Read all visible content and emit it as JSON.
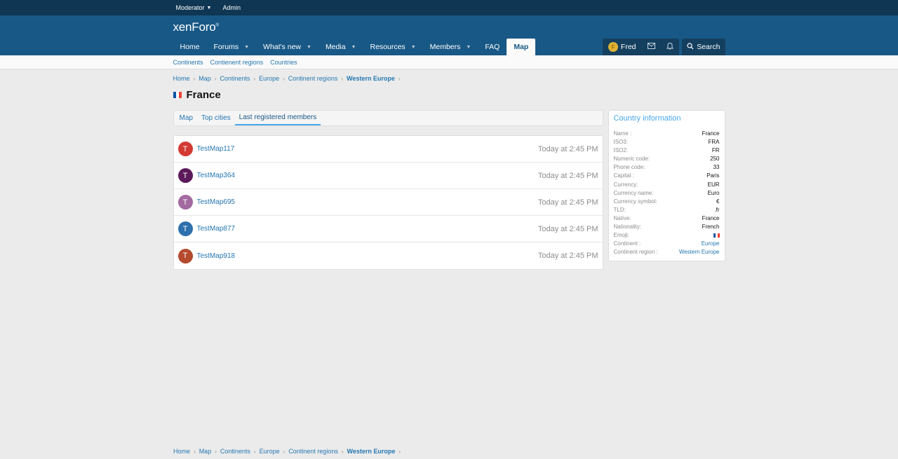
{
  "staffbar": {
    "moderator": "Moderator",
    "admin": "Admin"
  },
  "header": {
    "logo": "xenForo",
    "nav": [
      {
        "label": "Home",
        "dropdown": false
      },
      {
        "label": "Forums",
        "dropdown": true
      },
      {
        "label": "What's new",
        "dropdown": true
      },
      {
        "label": "Media",
        "dropdown": true
      },
      {
        "label": "Resources",
        "dropdown": true
      },
      {
        "label": "Members",
        "dropdown": true
      },
      {
        "label": "FAQ",
        "dropdown": false
      },
      {
        "label": "Map",
        "dropdown": false
      }
    ],
    "user": "Fred",
    "user_initial": "F",
    "search": "Search"
  },
  "subnav": [
    "Continents",
    "Contienent regions",
    "Countries"
  ],
  "breadcrumb": [
    "Home",
    "Map",
    "Continents",
    "Europe",
    "Continent regions",
    "Western Europe"
  ],
  "page": {
    "title": "France",
    "flag_colors": [
      "#0055a4",
      "#ffffff",
      "#ef4135"
    ]
  },
  "tabs": [
    "Map",
    "Top cities",
    "Last registered members"
  ],
  "members": [
    {
      "initial": "T",
      "name": "TestMap117",
      "time": "Today at 2:45 PM",
      "color": "#d33a34"
    },
    {
      "initial": "T",
      "name": "TestMap364",
      "time": "Today at 2:45 PM",
      "color": "#5c1a5b"
    },
    {
      "initial": "T",
      "name": "TestMap695",
      "time": "Today at 2:45 PM",
      "color": "#a26aa0"
    },
    {
      "initial": "T",
      "name": "TestMap877",
      "time": "Today at 2:45 PM",
      "color": "#2e6fad"
    },
    {
      "initial": "T",
      "name": "TestMap918",
      "time": "Today at 2:45 PM",
      "color": "#b54a2e"
    }
  ],
  "country_info": {
    "title": "Country information",
    "rows": [
      {
        "k": "Name :",
        "v": "France"
      },
      {
        "k": "ISO3:",
        "v": "FRA"
      },
      {
        "k": "ISO2:",
        "v": "FR"
      },
      {
        "k": "Numeric code:",
        "v": "250"
      },
      {
        "k": "Phone code:",
        "v": "33"
      },
      {
        "k": "Capital :",
        "v": "Paris"
      },
      {
        "k": "Currency:",
        "v": "EUR"
      },
      {
        "k": "Currency name:",
        "v": "Euro"
      },
      {
        "k": "Currency symbol:",
        "v": "€"
      },
      {
        "k": "TLD:",
        "v": ".fr"
      },
      {
        "k": "Native:",
        "v": "France"
      },
      {
        "k": "Nationality:",
        "v": "French"
      },
      {
        "k": "Emoji:",
        "v": "",
        "flag": true
      },
      {
        "k": "Continent :",
        "v": "Europe",
        "link": true
      },
      {
        "k": "Continent region :",
        "v": "Western Europe",
        "link": true
      }
    ]
  }
}
